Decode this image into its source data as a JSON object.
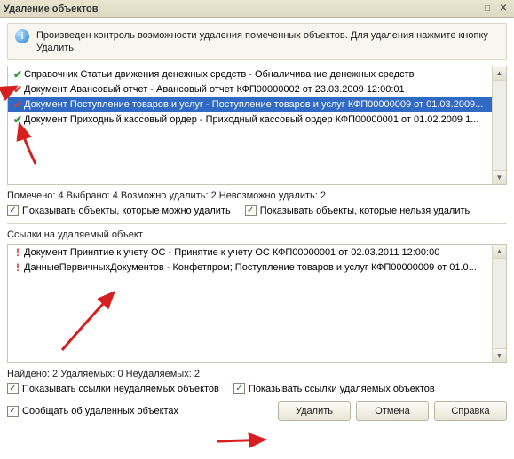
{
  "window": {
    "title": "Удаление объектов"
  },
  "info": {
    "text": "Произведен контроль возможности удаления помеченных объектов. Для удаления нажмите кнопку Удалить."
  },
  "objects": {
    "items": [
      {
        "marker": "green",
        "text": "Справочник Статьи движения денежных средств - Обналичивание денежных средств"
      },
      {
        "marker": "red",
        "text": "Документ Авансовый отчет - Авансовый отчет КФП00000002 от 23.03.2009 12:00:01"
      },
      {
        "marker": "red",
        "text": "Документ Поступление товаров и услуг - Поступление товаров и услуг КФП00000009 от 01.03.2009...",
        "selected": true
      },
      {
        "marker": "green",
        "text": "Документ Приходный кассовый ордер - Приходный кассовый ордер КФП00000001 от 01.02.2009 1..."
      }
    ]
  },
  "status1": "Помечено: 4  Выбрано: 4  Возможно удалить: 2  Невозможно удалить: 2",
  "check1a": "Показывать объекты, которые можно удалить",
  "check1b": "Показывать объекты, которые нельзя удалить",
  "refsTitle": "Ссылки на удаляемый объект",
  "refs": {
    "items": [
      {
        "marker": "red",
        "text": "Документ Принятие к учету ОС - Принятие к учету ОС КФП00000001 от 02.03.2011 12:00:00"
      },
      {
        "marker": "red",
        "text": "ДанныеПервичныхДокументов  - Конфетпром; Поступление товаров и услуг КФП00000009 от 01.0..."
      }
    ]
  },
  "status2": "Найдено: 2  Удаляемых: 0  Неудаляемых: 2",
  "check2a": "Показывать ссылки неудаляемых объектов",
  "check2b": "Показывать ссылки удаляемых объектов",
  "check3": "Сообщать об удаленных объектах",
  "buttons": {
    "delete": "Удалить",
    "cancel": "Отмена",
    "help": "Справка"
  }
}
